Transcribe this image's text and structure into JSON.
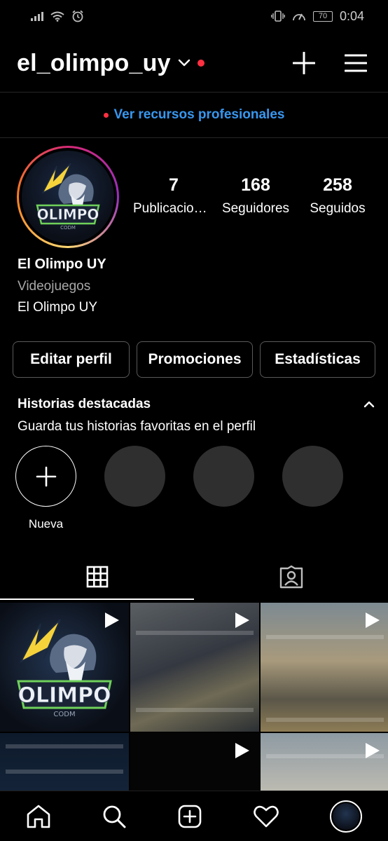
{
  "status_bar": {
    "time": "0:04",
    "battery": "70",
    "icons": [
      "signal-icon",
      "wifi-icon",
      "alarm-icon",
      "vibrate-icon",
      "speed-icon",
      "battery-icon"
    ]
  },
  "header": {
    "username": "el_olimpo_uy",
    "has_notification_dot": true,
    "icons": [
      "chevron-down-icon",
      "plus-icon",
      "menu-icon"
    ]
  },
  "professional": {
    "link_text": "Ver recursos profesionales"
  },
  "profile": {
    "avatar_icon": "olimpo-logo-avatar",
    "logo_text": "OLIMPO",
    "logo_sub": "CODM",
    "stats": [
      {
        "value": "7",
        "label": "Publicaciones"
      },
      {
        "value": "168",
        "label": "Seguidores"
      },
      {
        "value": "258",
        "label": "Seguidos"
      }
    ],
    "name": "El Olimpo UY",
    "category": "Videojuegos",
    "bio": "El Olimpo UY"
  },
  "buttons": {
    "edit": "Editar perfil",
    "promote": "Promociones",
    "insights": "Estadísticas"
  },
  "highlights": {
    "title": "Historias destacadas",
    "subtitle": "Guarda tus historias favoritas en el perfil",
    "new_label": "Nueva"
  },
  "tabs": [
    {
      "icon": "grid-icon",
      "active": true
    },
    {
      "icon": "tagged-icon",
      "active": false
    }
  ],
  "posts": [
    {
      "type": "reel",
      "icon": "play-icon"
    },
    {
      "type": "reel",
      "icon": "play-icon"
    },
    {
      "type": "reel",
      "icon": "play-icon"
    },
    {
      "type": "photo",
      "icon": ""
    },
    {
      "type": "reel",
      "icon": "play-icon"
    },
    {
      "type": "reel",
      "icon": "play-icon"
    }
  ],
  "bottom_nav": [
    "home-icon",
    "search-icon",
    "new-post-icon",
    "activity-heart-icon",
    "profile-avatar"
  ],
  "colors": {
    "background": "#000000",
    "accent_link": "#3897f0",
    "notification": "#ff3040",
    "button_border": "#5a5a5a",
    "highlight_placeholder": "#2f2f2f"
  }
}
